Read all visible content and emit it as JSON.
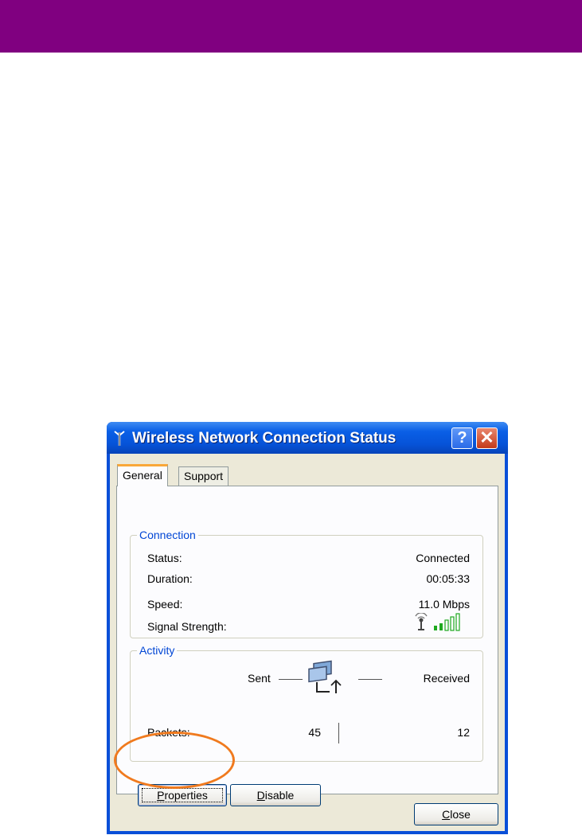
{
  "page": {
    "banner_color": "#800080"
  },
  "dialog": {
    "title": "Wireless Network Connection Status",
    "title_icon": "antenna-icon",
    "help_label": "?",
    "close_label": "✕",
    "tabs": [
      {
        "label": "General",
        "active": true
      },
      {
        "label": "Support",
        "active": false
      }
    ],
    "connection": {
      "legend": "Connection",
      "rows": [
        {
          "label": "Status:",
          "value": "Connected"
        },
        {
          "label": "Duration:",
          "value": "00:05:33"
        },
        {
          "label": "Speed:",
          "value": "11.0 Mbps"
        },
        {
          "label": "Signal Strength:",
          "value": "",
          "icon": "signal-strength-icon",
          "bars_filled": 2,
          "bars_total": 5
        }
      ]
    },
    "activity": {
      "legend": "Activity",
      "sent_label": "Sent",
      "received_label": "Received",
      "packets_label": "Packets:",
      "packets_sent": "45",
      "packets_received": "12",
      "icon": "network-activity-icon"
    },
    "buttons": {
      "properties_first": "P",
      "properties_rest": "roperties",
      "disable_first": "D",
      "disable_rest": "isable",
      "close_first": "C",
      "close_rest": "lose"
    },
    "highlight_color": "#f07a1e"
  }
}
